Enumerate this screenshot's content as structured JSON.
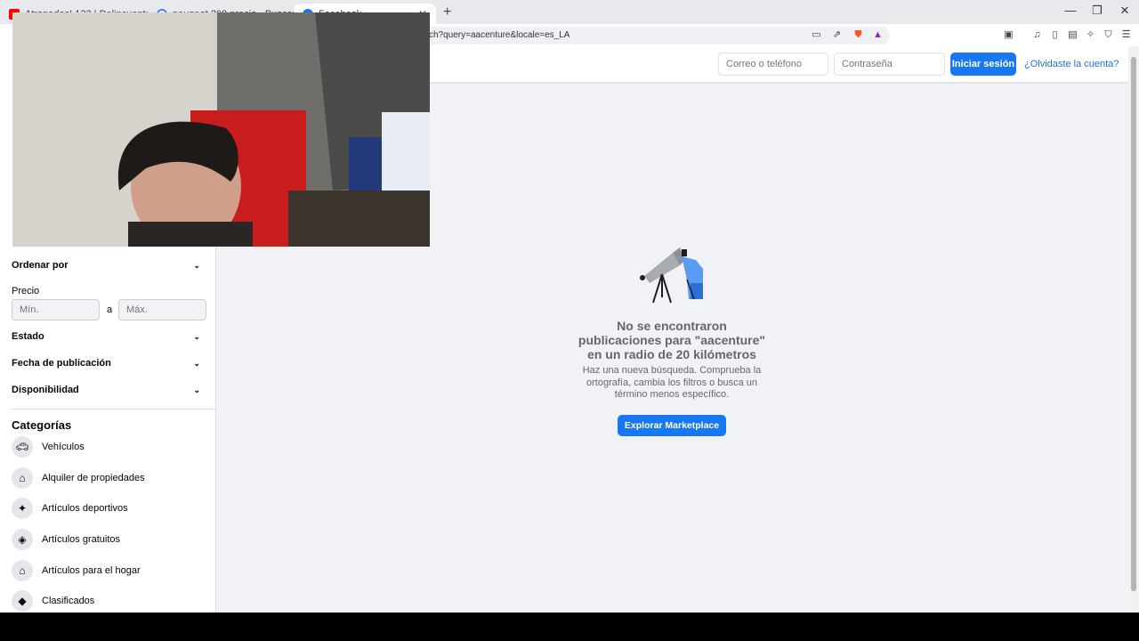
{
  "browser": {
    "tabs": [
      {
        "title": "Atrapados! 133 | Delincuentes traici",
        "icon": "youtube-icon",
        "color": "#ff0000"
      },
      {
        "title": "peugeot 208 precio - Buscar con Go",
        "icon": "google-icon",
        "color": "#4285f4"
      },
      {
        "title": "Facebook",
        "icon": "facebook-icon",
        "color": "#1877f2"
      }
    ],
    "url": "ch?query=aacenture&locale=es_LA",
    "window_controls": [
      "—",
      "❐",
      "✕"
    ]
  },
  "header": {
    "email_placeholder": "Correo o teléfono",
    "password_placeholder": "Contraseña",
    "login_label": "Iniciar sesión",
    "forgot_label": "¿Olvidaste la cuenta?"
  },
  "sidebar": {
    "sort_label": "Ordenar por",
    "price_label": "Precio",
    "price_min_placeholder": "Mín.",
    "price_separator": "a",
    "price_max_placeholder": "Máx.",
    "filters": [
      "Estado",
      "Fecha de publicación",
      "Disponibilidad"
    ],
    "categories_title": "Categorías",
    "categories": [
      {
        "label": "Vehículos",
        "icon": "car-icon"
      },
      {
        "label": "Alquiler de propiedades",
        "icon": "house-dollar-icon"
      },
      {
        "label": "Artículos deportivos",
        "icon": "runner-icon"
      },
      {
        "label": "Artículos gratuitos",
        "icon": "tag-icon"
      },
      {
        "label": "Artículos para el hogar",
        "icon": "home-icon"
      },
      {
        "label": "Clasificados",
        "icon": "label-icon"
      }
    ]
  },
  "empty_state": {
    "title": "No se encontraron publicaciones para \"aacenture\" en un radio de 20 kilómetros",
    "description": "Haz una nueva búsqueda. Comprueba la ortografía, cambia los filtros o busca un término menos específico.",
    "button_label": "Explorar Marketplace"
  },
  "colors": {
    "accent": "#1877f2",
    "page_bg": "#f0f2f5"
  }
}
